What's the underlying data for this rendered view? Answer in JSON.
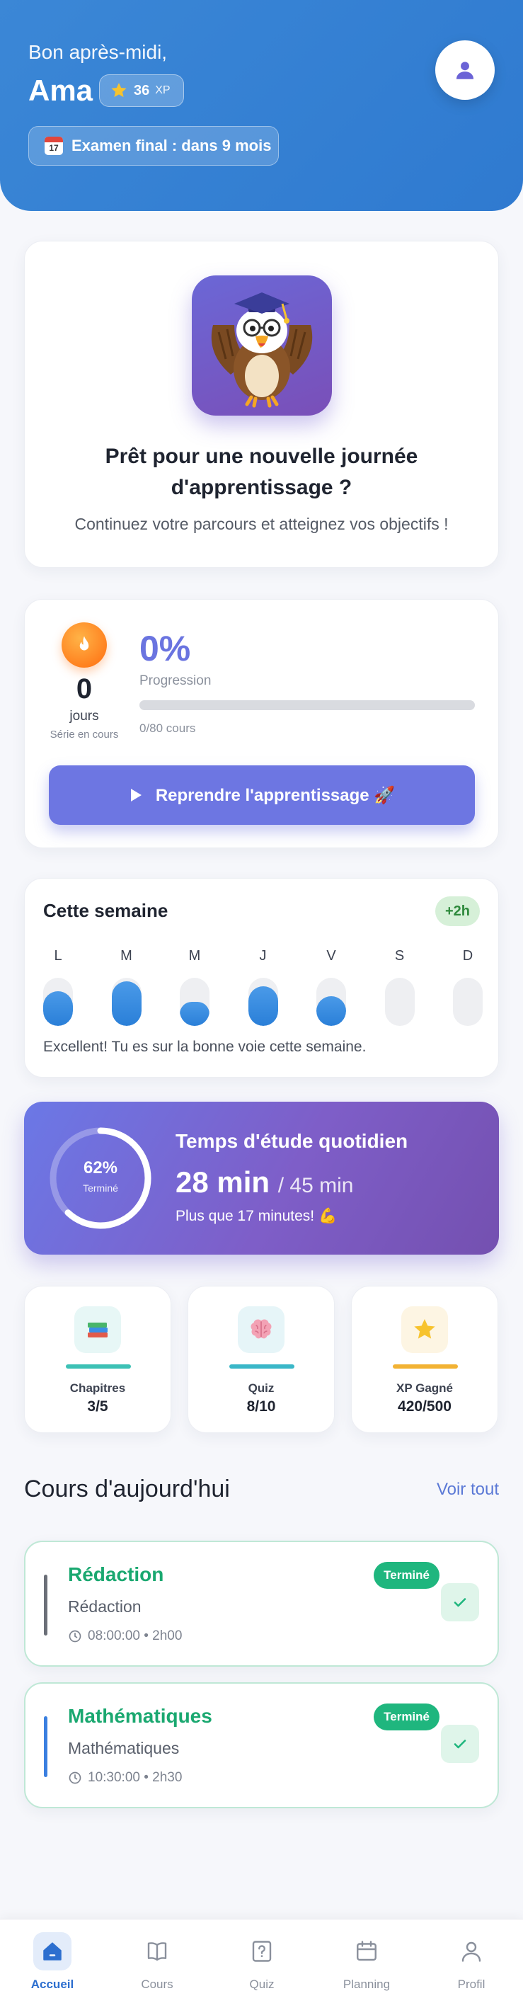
{
  "colors": {
    "primary": "#3b87d6",
    "accent": "#6d76e2",
    "success": "#1fb67e",
    "streak": "#ff7a1a"
  },
  "header": {
    "greeting": "Bon après-midi,",
    "name": "Ama",
    "xp_value": "36",
    "xp_unit": "XP",
    "exam_label": "Examen final : dans 9 mois"
  },
  "welcome": {
    "title": "Prêt pour une nouvelle journée d'apprentissage ?",
    "subtitle": "Continuez votre parcours et atteignez vos objectifs !"
  },
  "progress": {
    "streak_days": "0",
    "streak_unit": "jours",
    "streak_caption": "Série en cours",
    "percent_label": "0%",
    "percent_fraction": 0,
    "label": "Progression",
    "courses_count": "0/80 cours",
    "resume_label": "Reprendre l'apprentissage 🚀"
  },
  "week": {
    "title": "Cette semaine",
    "badge": "+2h",
    "days": [
      {
        "letter": "L",
        "level": 0.72
      },
      {
        "letter": "M",
        "level": 0.92
      },
      {
        "letter": "M",
        "level": 0.5
      },
      {
        "letter": "J",
        "level": 0.82
      },
      {
        "letter": "V",
        "level": 0.62
      },
      {
        "letter": "S",
        "level": 0
      },
      {
        "letter": "D",
        "level": 0
      }
    ],
    "message": "Excellent! Tu es sur la bonne voie cette semaine."
  },
  "study": {
    "ring_percent_label": "62%",
    "ring_fraction": 0.62,
    "ring_caption": "Terminé",
    "title": "Temps d'étude quotidien",
    "minutes": "28 min",
    "goal": "/ 45 min",
    "message": "Plus que 17 minutes! 💪"
  },
  "stats": [
    {
      "icon": "books-icon",
      "label": "Chapitres",
      "value": "3/5",
      "color": "#3cc1b5",
      "bg": "#e7f7f6"
    },
    {
      "icon": "brain-icon",
      "label": "Quiz",
      "value": "8/10",
      "color": "#3ab7c8",
      "bg": "#e6f5f8"
    },
    {
      "icon": "star-icon",
      "label": "XP Gagné",
      "value": "420/500",
      "color": "#f2b233",
      "bg": "#fdf5e3"
    }
  ],
  "today": {
    "title": "Cours d'aujourd'hui",
    "see_all": "Voir tout",
    "courses": [
      {
        "name": "Rédaction",
        "subject": "Rédaction",
        "time": "08:00:00 • 2h00",
        "status": "Terminé",
        "accent": "#6b6f78"
      },
      {
        "name": "Mathématiques",
        "subject": "Mathématiques",
        "time": "10:30:00 • 2h30",
        "status": "Terminé",
        "accent": "#3a7fe0"
      }
    ]
  },
  "tabbar": {
    "items": [
      {
        "label": "Accueil",
        "icon": "home-icon"
      },
      {
        "label": "Cours",
        "icon": "book-icon"
      },
      {
        "label": "Quiz",
        "icon": "quiz-icon"
      },
      {
        "label": "Planning",
        "icon": "calendar-icon"
      },
      {
        "label": "Profil",
        "icon": "profile-icon"
      }
    ]
  }
}
